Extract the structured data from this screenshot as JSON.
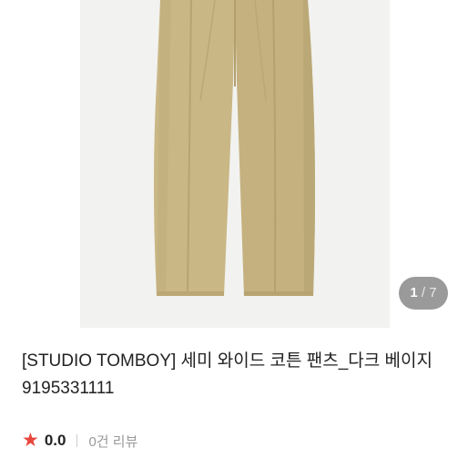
{
  "product": {
    "image_alt": "semi wide cotton pants photo",
    "pager": {
      "current": "1",
      "separator": "/",
      "total": "7"
    },
    "title": "[STUDIO TOMBOY] 세미 와이드 코튼 팬츠_다크 베이지 9195331111",
    "rating": "0.0",
    "reviews": "0건 리뷰",
    "colors": {
      "pants": "#c9b785",
      "star": "#e8463c"
    }
  }
}
